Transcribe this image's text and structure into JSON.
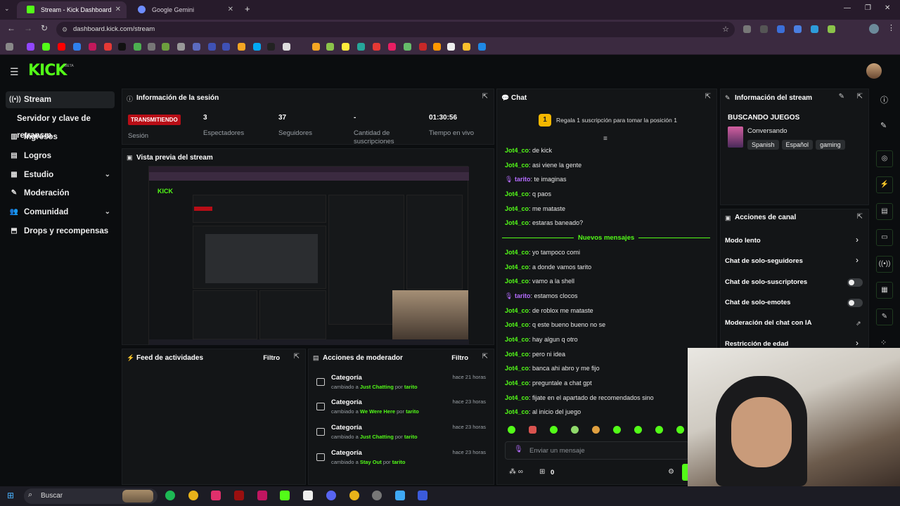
{
  "browser": {
    "tabs": [
      {
        "label": "Stream - Kick Dashboard",
        "active": true
      },
      {
        "label": "Google Gemini",
        "active": false
      }
    ],
    "url": "dashboard.kick.com/stream"
  },
  "kick": {
    "logo": "KICK",
    "beta": "BETA"
  },
  "sidebar": {
    "items": [
      {
        "label": "Stream",
        "icon": "broadcast-icon"
      },
      {
        "label": "Servidor y clave de retransm",
        "icon": ""
      },
      {
        "label": "Ingresos",
        "icon": "revenue-icon"
      },
      {
        "label": "Logros",
        "icon": "achievements-icon"
      },
      {
        "label": "Estudio",
        "icon": "studio-icon"
      },
      {
        "label": "Moderación",
        "icon": "wrench-icon"
      },
      {
        "label": "Comunidad",
        "icon": "community-icon"
      },
      {
        "label": "Drops y recompensas",
        "icon": "drops-icon"
      }
    ]
  },
  "session": {
    "title": "Información de la sesión",
    "status": "TRANSMITIENDO",
    "status_label": "Sesión",
    "stats": [
      {
        "value": "3",
        "label": "Espectadores"
      },
      {
        "value": "37",
        "label": "Seguidores"
      },
      {
        "value": "-",
        "label": "Cantidad de suscripciones"
      },
      {
        "value": "01:30:56",
        "label": "Tiempo en vivo"
      }
    ]
  },
  "preview": {
    "title": "Vista previa del stream"
  },
  "activity": {
    "title": "Feed de actividades",
    "filter": "Filtro"
  },
  "modactions": {
    "title": "Acciones de moderador",
    "filter": "Filtro",
    "items": [
      {
        "title": "Categoría",
        "changed": "cambiado a",
        "to": "Just Chatting",
        "by": "por",
        "user": "tarito",
        "time": "hace 21 horas"
      },
      {
        "title": "Categoría",
        "changed": "cambiado a",
        "to": "We Were Here",
        "by": "por",
        "user": "tarito",
        "time": "hace 23 horas"
      },
      {
        "title": "Categoría",
        "changed": "cambiado a",
        "to": "Just Chatting",
        "by": "por",
        "user": "tarito",
        "time": "hace 23 horas"
      },
      {
        "title": "Categoría",
        "changed": "cambiado a",
        "to": "Stay Out",
        "by": "por",
        "user": "tarito",
        "time": "hace 23 horas"
      }
    ]
  },
  "chat": {
    "title": "Chat",
    "gift_rank": "1",
    "gift_text": "Regala 1 suscripción para tomar la posición 1",
    "new_messages": "Nuevos mensajes",
    "placeholder": "Enviar un mensaje",
    "footer_count": "0",
    "messages": [
      {
        "user": "Jot4_co",
        "text": "de kick",
        "color": "green"
      },
      {
        "user": "Jot4_co",
        "text": "asi viene la gente",
        "color": "green"
      },
      {
        "user": "tarito",
        "text": "te imaginas",
        "color": "purple"
      },
      {
        "user": "Jot4_co",
        "text": "q paos",
        "color": "green"
      },
      {
        "user": "Jot4_co",
        "text": "me mataste",
        "color": "green"
      },
      {
        "user": "Jot4_co",
        "text": "estaras baneado?",
        "color": "green"
      },
      {
        "user": "Jot4_co",
        "text": "yo tampoco comi",
        "color": "green"
      },
      {
        "user": "Jot4_co",
        "text": "a donde vamos tarito",
        "color": "green"
      },
      {
        "user": "Jot4_co",
        "text": "vamo a la shell",
        "color": "green"
      },
      {
        "user": "tarito",
        "text": "estamos clocos",
        "color": "purple"
      },
      {
        "user": "Jot4_co",
        "text": "de roblox me mataste",
        "color": "green"
      },
      {
        "user": "Jot4_co",
        "text": "q este bueno bueno no se",
        "color": "green"
      },
      {
        "user": "Jot4_co",
        "text": "hay algun q otro",
        "color": "green"
      },
      {
        "user": "Jot4_co",
        "text": "pero ni idea",
        "color": "green"
      },
      {
        "user": "Jot4_co",
        "text": "banca ahi abro y me fijo",
        "color": "green"
      },
      {
        "user": "Jot4_co",
        "text": "preguntale a chat gpt",
        "color": "green"
      },
      {
        "user": "Jot4_co",
        "text": "fijate en el apartado de recomendados sino",
        "color": "green"
      },
      {
        "user": "Jot4_co",
        "text": "al inicio del juego",
        "color": "green"
      }
    ]
  },
  "streaminfo": {
    "title": "Información del stream",
    "stream_title": "BUSCANDO JUEGOS",
    "category": "Conversando",
    "tags": [
      "Spanish",
      "Español",
      "gaming"
    ]
  },
  "channel": {
    "title": "Acciones de canal",
    "items": [
      {
        "label": "Modo lento",
        "kind": "chevron"
      },
      {
        "label": "Chat de solo-seguidores",
        "kind": "chevron"
      },
      {
        "label": "Chat de solo-suscriptores",
        "kind": "toggle",
        "on": false
      },
      {
        "label": "Chat de solo-emotes",
        "kind": "toggle",
        "on": false
      },
      {
        "label": "Moderación del chat con IA",
        "kind": "external"
      },
      {
        "label": "Restricción de edad",
        "kind": "chevron"
      }
    ]
  },
  "taskbar": {
    "search": "Buscar"
  },
  "colors": {
    "accent": "#53fc18",
    "live": "#b80d16",
    "user_purple": "#b56cff"
  }
}
